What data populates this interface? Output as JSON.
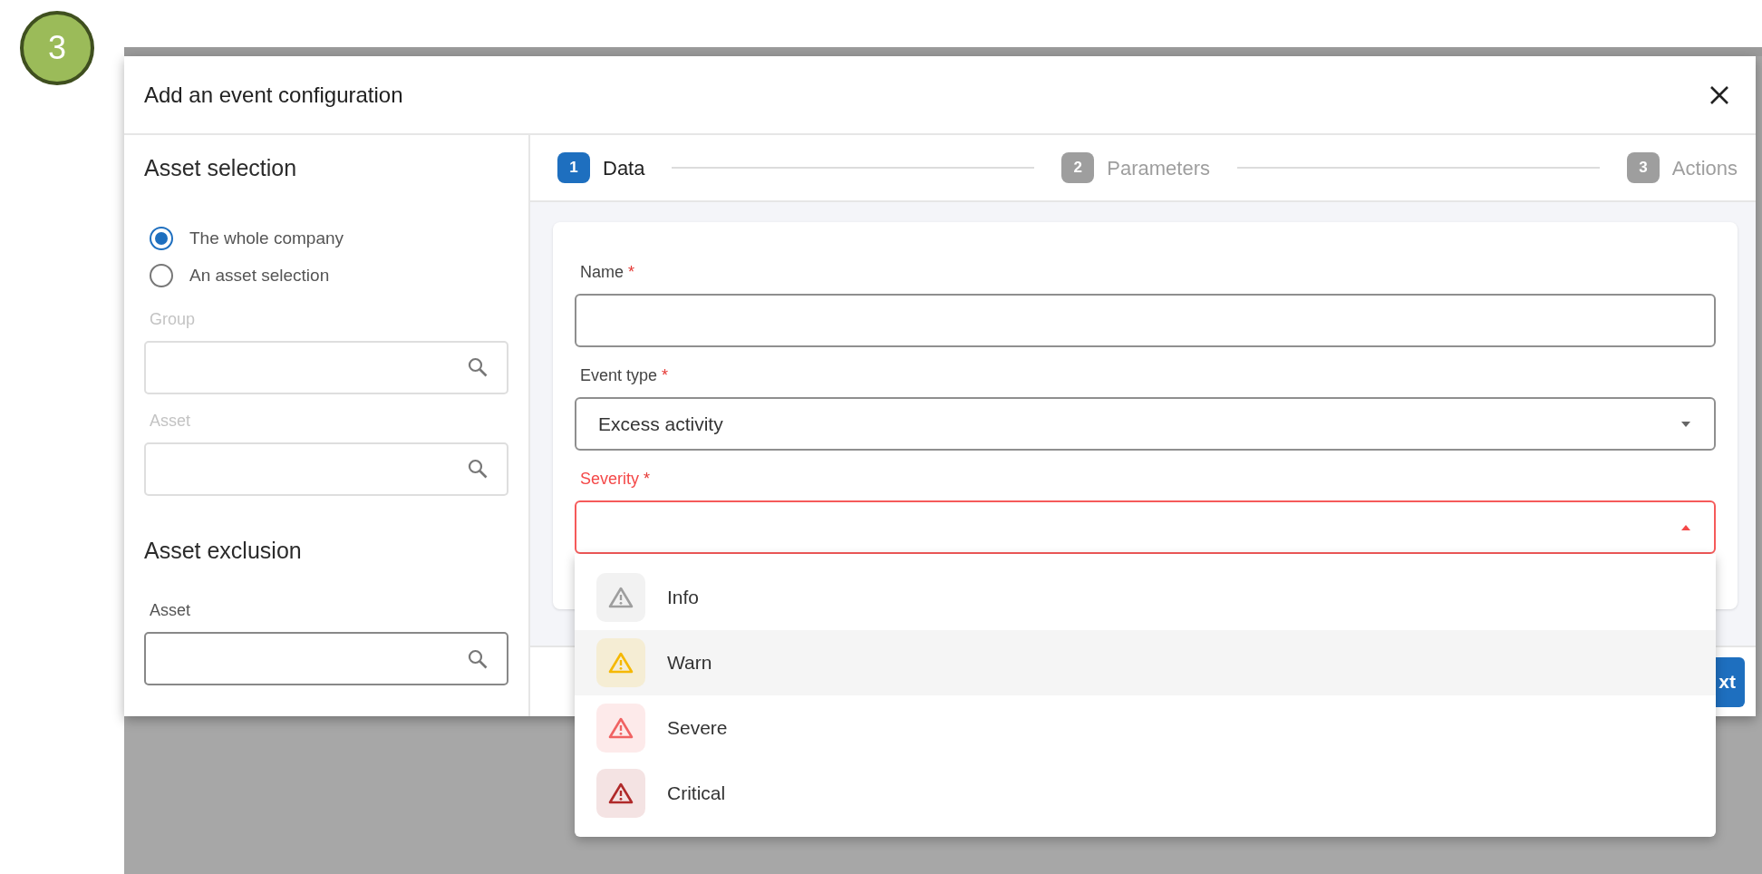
{
  "step_badge": "3",
  "dialog": {
    "title": "Add an event configuration"
  },
  "asset_selection": {
    "heading": "Asset selection",
    "options": [
      {
        "label": "The whole company",
        "selected": true
      },
      {
        "label": "An asset selection",
        "selected": false
      }
    ],
    "fields": [
      {
        "label": "Group",
        "disabled": true
      },
      {
        "label": "Asset",
        "disabled": true
      }
    ]
  },
  "asset_exclusion": {
    "heading": "Asset exclusion",
    "fields": [
      {
        "label": "Asset",
        "disabled": false
      }
    ]
  },
  "stepper": [
    {
      "number": "1",
      "label": "Data",
      "selected": true
    },
    {
      "number": "2",
      "label": "Parameters",
      "selected": false
    },
    {
      "number": "3",
      "label": "Actions",
      "selected": false
    }
  ],
  "form": {
    "fields": [
      {
        "kind": "text",
        "label": "Name",
        "required_mark": "*",
        "invalid": false
      },
      {
        "kind": "select",
        "label": "Event type",
        "required_mark": "*",
        "value": "Excess activity",
        "invalid": false,
        "expanded": false
      },
      {
        "kind": "select",
        "label": "Severity",
        "required_mark": "*",
        "invalid": true,
        "expanded": true
      }
    ]
  },
  "severity_options": [
    {
      "label": "Info",
      "color": "#9e9e9e",
      "highlighted": false
    },
    {
      "label": "Warn",
      "color": "#f5b800",
      "highlighted": true
    },
    {
      "label": "Severe",
      "color": "#f06262",
      "highlighted": false
    },
    {
      "label": "Critical",
      "color": "#b02a2a",
      "highlighted": false
    }
  ],
  "footer": {
    "next_button": "xt"
  }
}
